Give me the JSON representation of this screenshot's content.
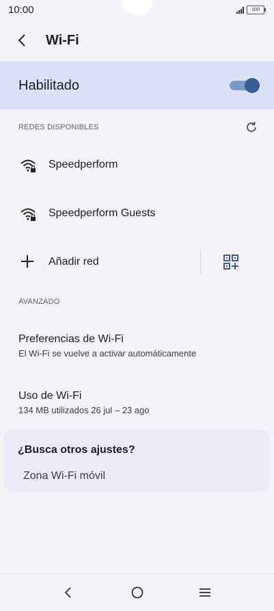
{
  "status_bar": {
    "time": "10:00",
    "battery": "100",
    "signal_icon": "signal-icon"
  },
  "header": {
    "title": "Wi-Fi",
    "back_icon": "back-arrow-icon"
  },
  "wifi_toggle": {
    "label": "Habilitado",
    "enabled": true,
    "accent_color": "#3d5a94",
    "background_color": "#d9e2f6"
  },
  "available_networks": {
    "section_label": "REDES DISPONIBLES",
    "refresh_icon": "refresh-icon",
    "networks": [
      {
        "name": "Speedperform",
        "icon": "wifi-locked-icon"
      },
      {
        "name": "Speedperform Guests",
        "icon": "wifi-locked-icon"
      }
    ],
    "add_network_label": "Añadir red",
    "add_icon": "plus-icon",
    "qr_icon": "qr-code-scan-icon"
  },
  "advanced": {
    "section_label": "AVANZADO",
    "items": [
      {
        "title": "Preferencias de Wi-Fi",
        "subtitle": "El Wi-Fi se vuelve a activar automáticamente"
      },
      {
        "title": "Uso de Wi-Fi",
        "subtitle": "134 MB utilizados 26 jul – 23 ago"
      }
    ]
  },
  "suggestions": {
    "title": "¿Busca otros ajustes?",
    "link": "Zona Wi-Fi móvil"
  },
  "nav_bar": {
    "icons": [
      "nav-back-icon",
      "home-icon",
      "menu-icon"
    ]
  }
}
